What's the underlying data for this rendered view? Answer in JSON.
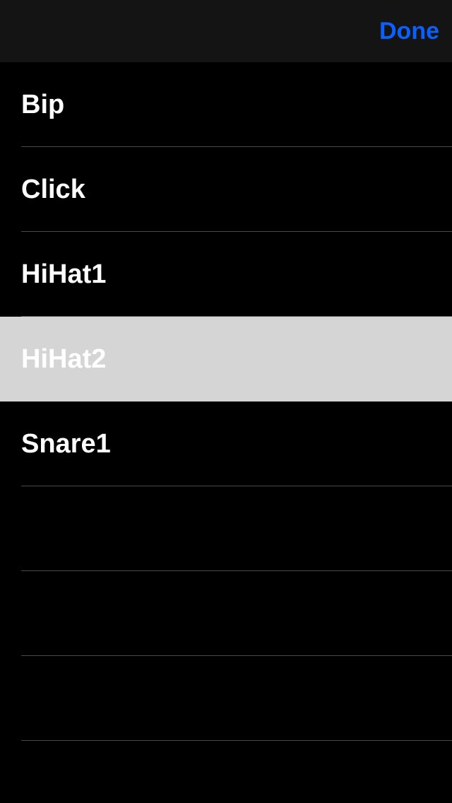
{
  "header": {
    "done_label": "Done"
  },
  "list": {
    "items": [
      {
        "label": "Bip",
        "selected": false
      },
      {
        "label": "Click",
        "selected": false
      },
      {
        "label": "HiHat1",
        "selected": false
      },
      {
        "label": "HiHat2",
        "selected": true
      },
      {
        "label": "Snare1",
        "selected": false
      }
    ]
  }
}
